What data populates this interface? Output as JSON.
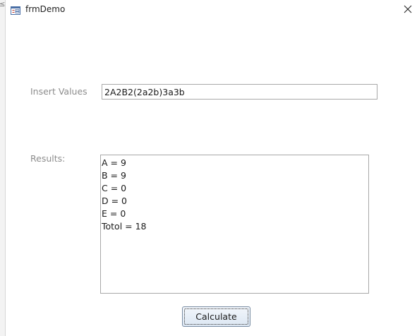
{
  "window": {
    "side_glyph": "≤",
    "title": "frmDemo",
    "close_icon": "close-icon",
    "form_icon": "form-icon"
  },
  "form": {
    "insert_label": "Insert Values",
    "insert_value": "2A2B2(2a2b)3a3b",
    "results_label": "Results:",
    "results_lines": [
      "A = 9",
      "B = 9",
      "C = 0",
      "D = 0",
      "E = 0",
      "Totol = 18"
    ],
    "calculate_label": "Calculate"
  },
  "colors": {
    "label_gray": "#8c8c8c",
    "input_border": "#a8a8a8",
    "button_border": "#7a8da3",
    "form_icon_accent": "#c0392b"
  }
}
